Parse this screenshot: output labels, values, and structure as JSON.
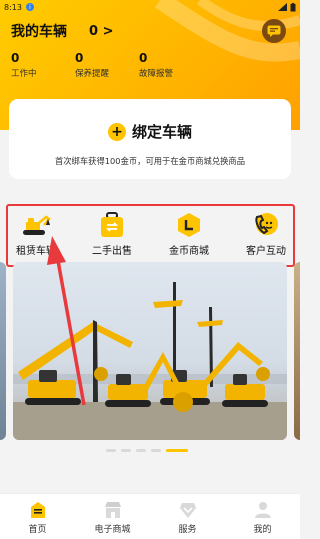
{
  "status_bar": {
    "time": "8:13",
    "badge": "i"
  },
  "header": {
    "title": "我的车辆",
    "count": "0",
    "arrow": ">",
    "message_icon": "message-icon"
  },
  "stats": [
    {
      "value": "0",
      "label": "工作中"
    },
    {
      "value": "0",
      "label": "保养提醒"
    },
    {
      "value": "0",
      "label": "故障报警"
    }
  ],
  "bind_card": {
    "plus": "+",
    "label": "绑定车辆",
    "hint": "首次绑车获得100金币，可用于在金币商城兑换商品"
  },
  "quick_actions": [
    {
      "label": "租赁车辆",
      "icon": "excavator-icon"
    },
    {
      "label": "二手出售",
      "icon": "bag-icon"
    },
    {
      "label": "金币商城",
      "icon": "coin-icon"
    },
    {
      "label": "客户互动",
      "icon": "phone-chat-icon"
    }
  ],
  "tabs": [
    {
      "label": "首页",
      "icon": "home-icon",
      "active": true
    },
    {
      "label": "电子商城",
      "icon": "shop-icon",
      "active": false
    },
    {
      "label": "服务",
      "icon": "service-icon",
      "active": false
    },
    {
      "label": "我的",
      "icon": "user-icon",
      "active": false
    }
  ],
  "colors": {
    "accent": "#ffc400",
    "highlight_box": "#e8393c"
  }
}
